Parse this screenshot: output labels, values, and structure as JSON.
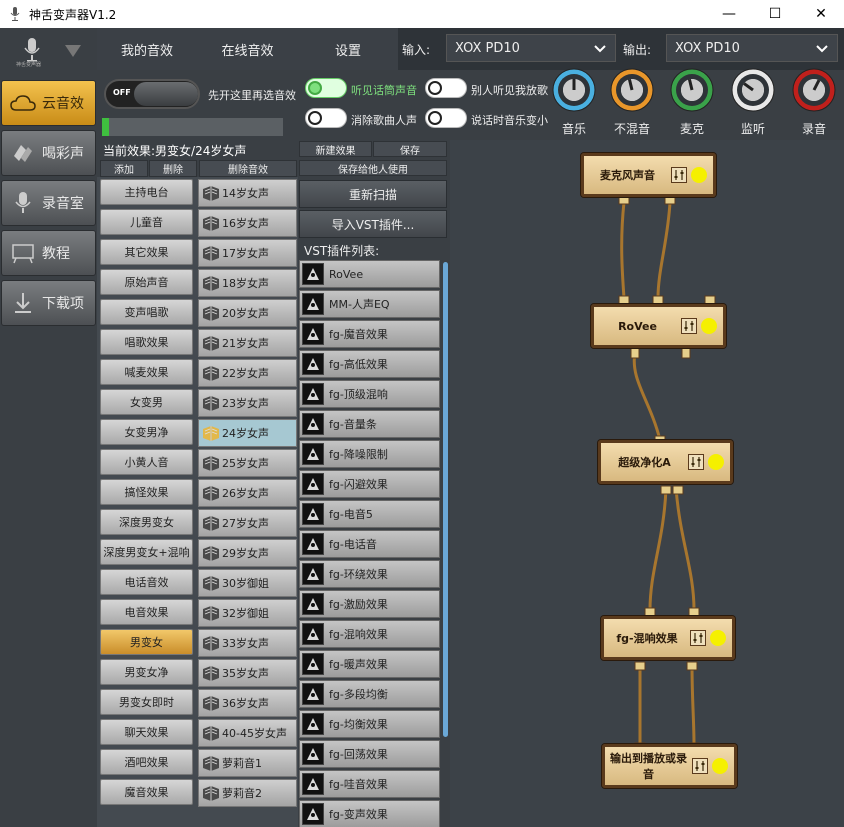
{
  "window": {
    "title": "神舌变声器V1.2",
    "logo_text": "神舌变声器",
    "min": "—",
    "max": "☐",
    "close": "✕"
  },
  "tabs": [
    "我的音效",
    "在线音效",
    "设置"
  ],
  "io": {
    "input_label": "输入:",
    "input_value": "XOX PD10",
    "output_label": "输出:",
    "output_value": "XOX PD10"
  },
  "nav": [
    "云音效",
    "喝彩声",
    "录音室",
    "教程",
    "下载项"
  ],
  "controls": {
    "off_label": "OFF",
    "off_hint": "先开这里再选音效",
    "t1": "听见话筒声音",
    "t2": "别人听见我放歌",
    "t3": "消除歌曲人声",
    "t4": "说话时音乐变小",
    "meter_level": 0.04
  },
  "dials": [
    {
      "label": "音乐",
      "color": "#4ab0e0",
      "level": 0.5
    },
    {
      "label": "不混音",
      "color": "#e8962a",
      "level": 0.45
    },
    {
      "label": "麦克",
      "color": "#3aa24a",
      "level": 0.45
    },
    {
      "label": "监听",
      "color": "#e8e8e8",
      "level": 0.3
    },
    {
      "label": "录音",
      "color": "#c0201c",
      "level": 0.6
    }
  ],
  "current": "当前效果:男变女/24岁女声",
  "headers": {
    "add": "添加",
    "del": "删除",
    "del_fx": "删除音效",
    "new_fx": "新建效果",
    "save": "保存",
    "save_share": "保存给他人使用",
    "rescan": "重新扫描",
    "import_vst": "导入VST插件...",
    "vst_list": "VST插件列表:"
  },
  "categories": [
    "主持电台",
    "儿童音",
    "其它效果",
    "原始声音",
    "变声唱歌",
    "唱歌效果",
    "喊麦效果",
    "女变男",
    "女变男净",
    "小黄人音",
    "搞怪效果",
    "深度男变女",
    "深度男变女+混响",
    "电话音效",
    "电音效果",
    "男变女",
    "男变女净",
    "男变女即时",
    "聊天效果",
    "酒吧效果",
    "魔音效果"
  ],
  "selected_category": 15,
  "presets": [
    "14岁女声",
    "16岁女声",
    "17岁女声",
    "18岁女声",
    "20岁女声",
    "21岁女声",
    "22岁女声",
    "23岁女声",
    "24岁女声",
    "25岁女声",
    "26岁女声",
    "27岁女声",
    "29岁女声",
    "30岁御姐",
    "32岁御姐",
    "33岁女声",
    "35岁女声",
    "36岁女声",
    "40-45岁女声",
    "萝莉音1",
    "萝莉音2"
  ],
  "selected_preset": 8,
  "vst_plugins": [
    "RoVee",
    "MM-人声EQ",
    "fg-魔音效果",
    "fg-高低效果",
    "fg-顶级混响",
    "fg-音量条",
    "fg-降噪限制",
    "fg-闪避效果",
    "fg-电音5",
    "fg-电话音",
    "fg-环绕效果",
    "fg-激励效果",
    "fg-混响效果",
    "fg-暖声效果",
    "fg-多段均衡",
    "fg-均衡效果",
    "fg-回荡效果",
    "fg-哇音效果",
    "fg-变声效果"
  ],
  "nodes": [
    "麦克风声音",
    "RoVee",
    "超级净化A",
    "fg-混响效果",
    "输出到播放或录音"
  ]
}
